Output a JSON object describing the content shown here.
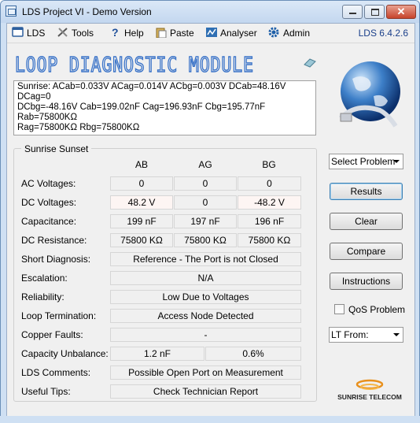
{
  "window": {
    "title": "LDS Project VI - Demo Version"
  },
  "menu": {
    "items": [
      {
        "label": "LDS",
        "icon": "window-icon"
      },
      {
        "label": "Tools",
        "icon": "tools-icon"
      },
      {
        "label": "Help",
        "icon": "help-icon"
      },
      {
        "label": "Paste",
        "icon": "clipboard-icon"
      },
      {
        "label": "Analyser",
        "icon": "analyser-icon"
      },
      {
        "label": "Admin",
        "icon": "gear-icon"
      }
    ],
    "version": "LDS 6.4.2.6"
  },
  "module_title": "LOOP DIAGNOSTIC MODULE",
  "status_text": [
    "Sunrise: ACab=0.033V ACag=0.014V ACbg=0.003V DCab=48.16V DCag=0",
    "DCbg=-48.16V Cab=199.02nF Cag=196.93nF Cbg=195.77nF Rab=75800KΩ",
    "Rag=75800KΩ Rbg=75800KΩ"
  ],
  "group_title": "Sunrise Sunset",
  "columns": [
    "AB",
    "AG",
    "BG"
  ],
  "rows": {
    "ac_voltages": {
      "label": "AC Voltages:",
      "values": [
        "0",
        "0",
        "0"
      ]
    },
    "dc_voltages": {
      "label": "DC Voltages:",
      "values": [
        "48.2 V",
        "0",
        "-48.2 V"
      ]
    },
    "capacitance": {
      "label": "Capacitance:",
      "values": [
        "199 nF",
        "197 nF",
        "196 nF"
      ]
    },
    "dc_resistance": {
      "label": "DC Resistance:",
      "values": [
        "75800 KΩ",
        "75800 KΩ",
        "75800 KΩ"
      ]
    },
    "short_diagnosis": {
      "label": "Short Diagnosis:",
      "value": "Reference - The Port is not Closed"
    },
    "escalation": {
      "label": "Escalation:",
      "value": "N/A"
    },
    "reliability": {
      "label": "Reliability:",
      "value": "Low Due to Voltages"
    },
    "loop_termination": {
      "label": "Loop Termination:",
      "value": "Access Node Detected"
    },
    "copper_faults": {
      "label": "Copper Faults:",
      "value": "-"
    },
    "capacity_unbalance": {
      "label": "Capacity Unbalance:",
      "values": [
        "1.2 nF",
        "0.6%"
      ]
    },
    "lds_comments": {
      "label": "LDS Comments:",
      "value": "Possible Open Port on Measurement"
    },
    "useful_tips": {
      "label": "Useful Tips:",
      "value": "Check Technician Report"
    }
  },
  "right_panel": {
    "select_problem": "Select Problem",
    "results": "Results",
    "clear": "Clear",
    "compare": "Compare",
    "instructions": "Instructions",
    "qos_problem": "QoS Problem",
    "lt_from": "LT From:",
    "brand": "SUNRISE TELECOM"
  },
  "colors": {
    "title_blue": "#3a73c8",
    "version_blue": "#1a3f8a",
    "brand_orange": "#e8901c"
  }
}
